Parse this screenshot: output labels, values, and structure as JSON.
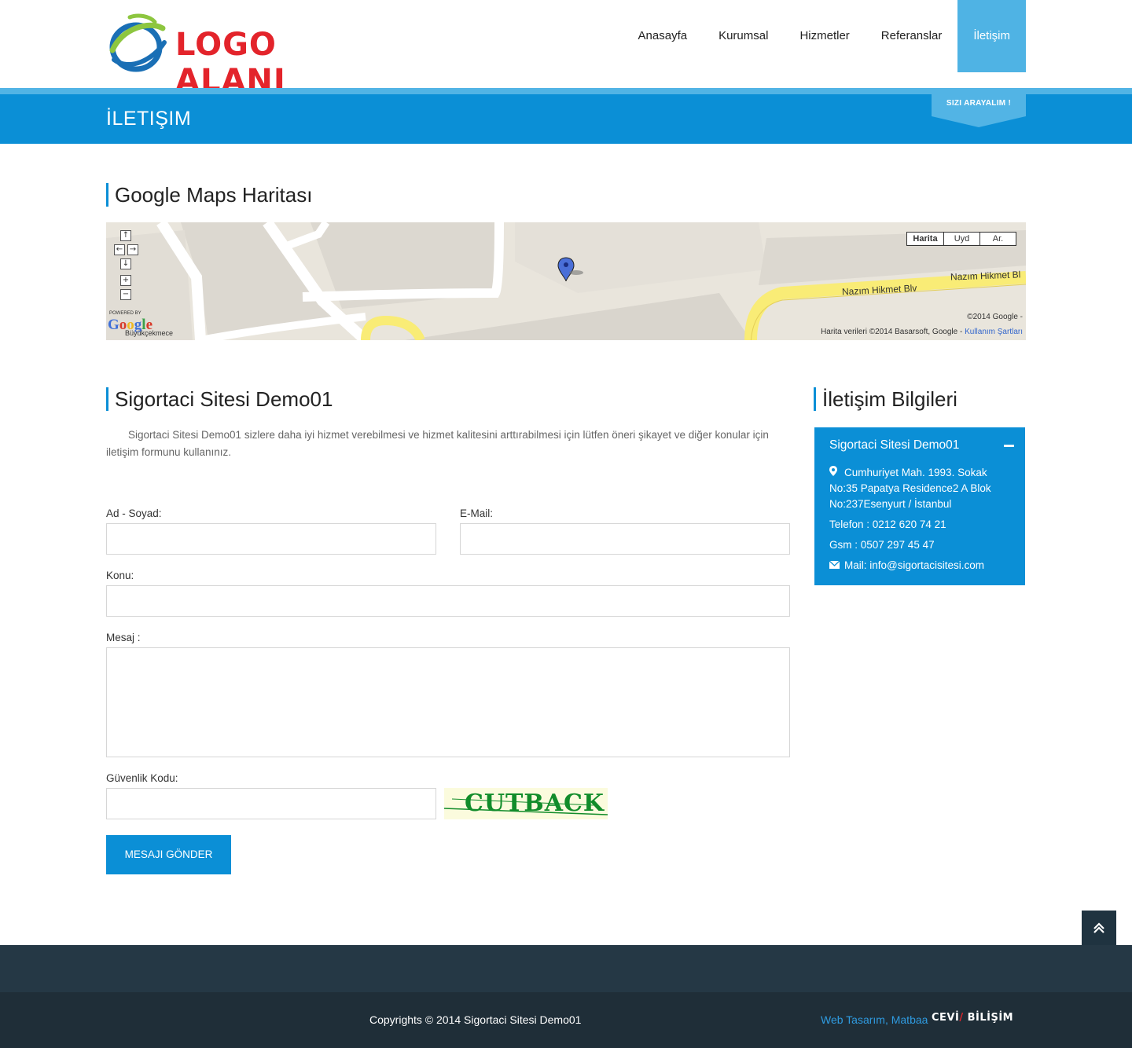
{
  "header": {
    "logo_text": "LOGO ALANI",
    "nav": [
      {
        "label": "Anasayfa",
        "active": false
      },
      {
        "label": "Kurumsal",
        "active": false
      },
      {
        "label": "Hizmetler",
        "active": false
      },
      {
        "label": "Referanslar",
        "active": false
      },
      {
        "label": "İletişim",
        "active": true
      }
    ]
  },
  "title_bar": {
    "title": "İLETIŞIM",
    "badge": "SIZI ARAYALIM !"
  },
  "map_section": {
    "heading": "Google Maps Haritası",
    "map_type_buttons": [
      "Harita",
      "Uyd",
      "Ar."
    ],
    "road_1": "Nazım Hikmet Blv",
    "road_2": "Nazım Hikmet Bl",
    "copyright_1": "©2014 Google -",
    "copyright_2": "Harita verileri ©2014 Basarsoft, Google -",
    "terms_link": "Kullanım Şartları",
    "powered_by": "POWERED BY",
    "place": "Büyükçekmece"
  },
  "form_section": {
    "heading": "Sigortaci Sitesi Demo01",
    "intro": "Sigortaci Sitesi Demo01 sizlere daha iyi hizmet verebilmesi ve hizmet kalitesini arttırabilmesi için lütfen öneri şikayet ve diğer konular için iletişim formunu kullanınız.",
    "labels": {
      "name": "Ad - Soyad:",
      "email": "E-Mail:",
      "subject": "Konu:",
      "message": "Mesaj :",
      "security": "Güvenlik Kodu:"
    },
    "captcha_text": "CUTBACK",
    "submit": "MESAJI GÖNDER"
  },
  "contact_section": {
    "heading": "İletişim Bilgileri",
    "card_title": "Sigortaci Sitesi Demo01",
    "address": "Cumhuriyet Mah. 1993. Sokak No:35 Papatya Residence2 A Blok No:237Esenyurt / İstanbul",
    "phone": "Telefon : 0212 620 74 21",
    "gsm": "Gsm : 0507 297 45 47",
    "mail": "Mail: info@sigortacisitesi.com"
  },
  "footer": {
    "copyright": "Copyrights © 2014   Sigortaci Sitesi Demo01",
    "credit_link": "Web Tasarım, Matbaa",
    "brand_a": "CEVİ",
    "brand_b": "BİLİŞİM"
  },
  "colors": {
    "primary": "#0b8fd6",
    "light": "#52b4e5",
    "footer_dark": "#1f2e38",
    "logo_red": "#e3242b"
  }
}
